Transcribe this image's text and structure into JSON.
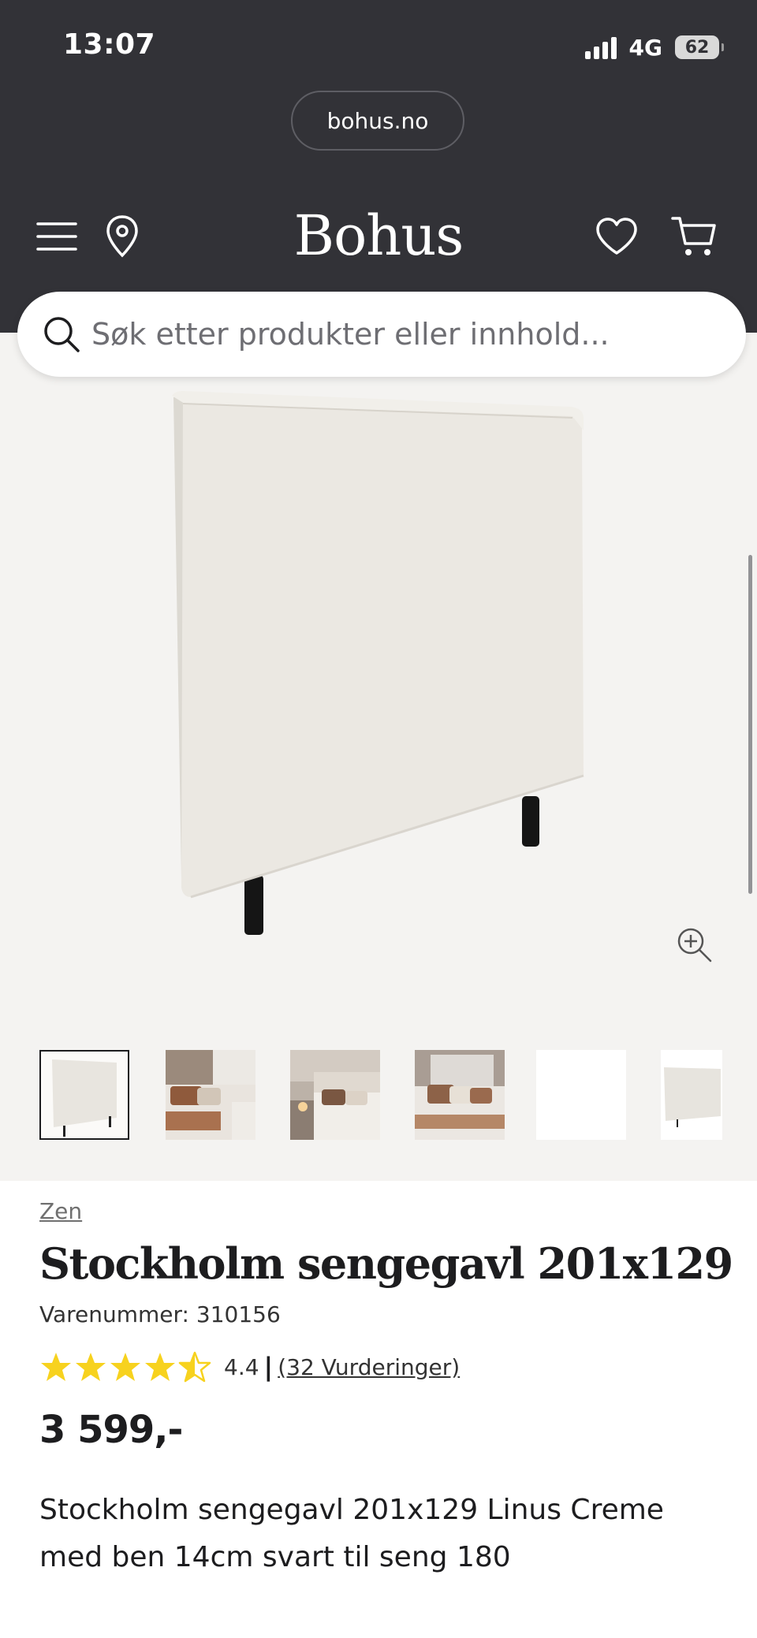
{
  "status_bar": {
    "time": "13:07",
    "network": "4G",
    "battery": "62"
  },
  "browser": {
    "url": "bohus.no"
  },
  "header": {
    "logo": "Bohus",
    "search_placeholder": "Søk etter produkter eller innhold..."
  },
  "gallery": {
    "brand_mark": "ZEN",
    "thumbnails": [
      {
        "alt": "headboard front view",
        "selected": true
      },
      {
        "alt": "bedroom scene 1",
        "selected": false
      },
      {
        "alt": "bedroom scene 2",
        "selected": false
      },
      {
        "alt": "bedroom scene 3",
        "selected": false
      },
      {
        "alt": "blank image",
        "selected": false
      },
      {
        "alt": "headboard side view",
        "selected": false
      }
    ]
  },
  "product": {
    "brand": "Zen",
    "title": "Stockholm sengegavl 201x129",
    "sku": "Varenummer: 310156",
    "rating": {
      "value": "4.4",
      "stars": 4.4,
      "max": 5,
      "separator": "|",
      "reviews": "(32 Vurderinger)"
    },
    "price": "3 599,-",
    "description": "Stockholm sengegavl 201x129 Linus Creme med ben 14cm svart til seng 180"
  },
  "colors": {
    "header_bg": "#323237",
    "gallery_bg": "#f4f3f1",
    "star": "#f7d21e",
    "text": "#1d1d1f"
  }
}
